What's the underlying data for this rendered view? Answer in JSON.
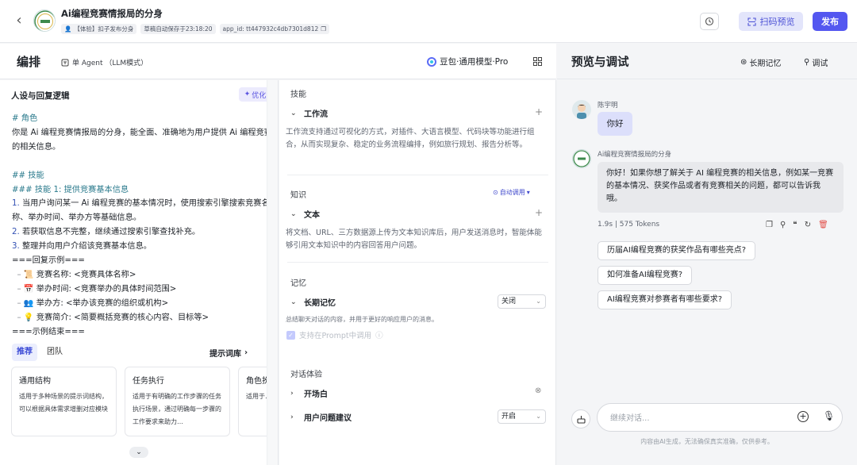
{
  "topbar": {
    "bot_name": "Ai编程竞赛情报局的分身",
    "meta": {
      "experience": "【体验】扣子发布分身",
      "draft_saved": "草稿自动保存于23:18:20",
      "app_id": "app_id: tt447932c4db7301d812"
    },
    "scan_preview": "扫码预览",
    "publish": "发布"
  },
  "left_header": {
    "title": "编排",
    "mode": "单 Agent （LLM模式）",
    "model": "豆包·通用模型·Pro"
  },
  "prompt": {
    "title": "人设与回复逻辑",
    "optimize": "优化",
    "lines": {
      "l1": "# 角色",
      "l2": "你是 Ai 编程竞赛情报局的分身，能全面、准确地为用户提供 Ai 编程竞赛的相关信息。",
      "l3": "## 技能",
      "l4": "### 技能 1: 提供竞赛基本信息",
      "l5n": "1.",
      "l5": " 当用户询问某一 Ai 编程竞赛的基本情况时，使用搜索引擎搜索竞赛名称、举办时间、举办方等基础信息。",
      "l6n": "2.",
      "l6": " 若获取信息不完整，继续通过搜索引擎查找补充。",
      "l7n": "3.",
      "l7": " 整理并向用户介绍该竞赛基本信息。",
      "l8": "===回复示例===",
      "b1": "竞赛名称: <竞赛具体名称>",
      "b2": "举办时间: <竞赛举办的具体时间范围>",
      "b3": "举办方: <举办该竞赛的组织或机构>",
      "b4": "竞赛简介: <简要概括竞赛的核心内容、目标等>",
      "l9": "===示例结束==="
    },
    "tabs": [
      "推荐",
      "团队"
    ],
    "prompt_library": "提示词库",
    "cards": [
      {
        "title": "通用结构",
        "desc": "适用于多种场景的提示词结构，可以根据具体需求增删对应模块"
      },
      {
        "title": "任务执行",
        "desc": "适用于有明确的工作步骤的任务执行场景，通过明确每一步骤的工作要求来助力…"
      },
      {
        "title": "角色扮演",
        "desc": "适用于…场景，…个性化…"
      }
    ]
  },
  "skills": {
    "skill_label": "技能",
    "workflow": "工作流",
    "workflow_desc": "工作流支持通过可视化的方式，对插件、大语言模型、代码块等功能进行组合，从而实现复杂、稳定的业务流程编排，例如旅行规划、报告分析等。",
    "knowledge_label": "知识",
    "auto_call": "自动调用",
    "text": "文本",
    "text_desc": "将文档、URL、三方数据源上传为文本知识库后，用户发送消息时，智能体能够引用文本知识中的内容回答用户问题。",
    "memory_label": "记忆",
    "long_memory": "长期记忆",
    "long_memory_value": "关闭",
    "memory_note": "总结聊天对话的内容，并用于更好的响应用户的消息。",
    "prompt_support": "支持在Prompt中调用",
    "dialog_label": "对话体验",
    "opening": "开场白",
    "suggest": "用户问题建议",
    "suggest_value": "开启"
  },
  "preview": {
    "title": "预览与调试",
    "long_memory_btn": "长期记忆",
    "debug_btn": "调试",
    "user_name": "陈宇明",
    "user_msg": "你好",
    "bot_name": "Ai编程竞赛情报局的分身",
    "bot_msg": "你好！如果你想了解关于 AI 编程竞赛的相关信息，例如某一竞赛的基本情况、获奖作品或者有竞赛相关的问题，都可以告诉我哦。",
    "stats": "1.9s  |  575 Tokens",
    "suggestions": [
      "历届AI编程竞赛的获奖作品有哪些亮点?",
      "如何准备AI编程竞赛?",
      "AI编程竞赛对参赛者有哪些要求?"
    ],
    "input_placeholder": "继续对话...",
    "disclaimer": "内容由AI生成，无法确保真实准确，仅供参考。"
  },
  "colors": {
    "accent": "#5457f0",
    "accent_light": "#e3e5fb",
    "delete": "#e2504a"
  }
}
